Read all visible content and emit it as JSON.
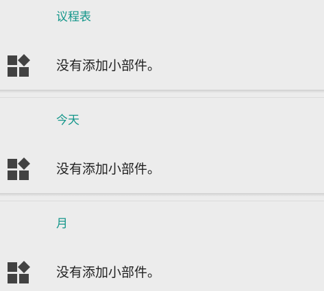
{
  "sections": [
    {
      "title": "议程表",
      "empty_text": "没有添加小部件。",
      "icon": "widgets-icon"
    },
    {
      "title": "今天",
      "empty_text": "没有添加小部件。",
      "icon": "widgets-icon"
    },
    {
      "title": "月",
      "empty_text": "没有添加小部件。",
      "icon": "widgets-icon"
    }
  ],
  "colors": {
    "background": "#ececec",
    "section_title": "#13968a",
    "text": "#222222",
    "icon": "#424242"
  }
}
